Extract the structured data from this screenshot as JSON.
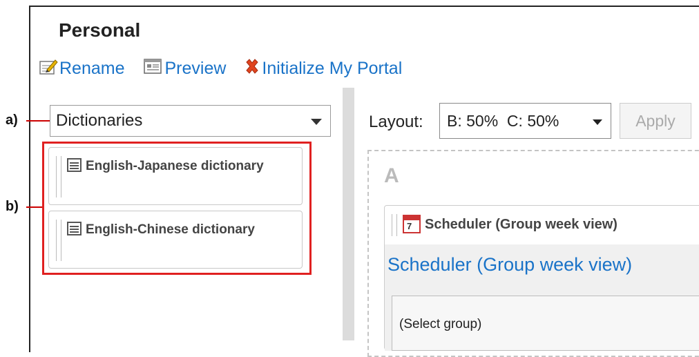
{
  "page": {
    "title": "Personal"
  },
  "toolbar": {
    "rename_label": "Rename",
    "preview_label": "Preview",
    "initialize_label": "Initialize My Portal"
  },
  "left": {
    "category_select": "Dictionaries",
    "items": [
      {
        "label": "English-Japanese dictionary"
      },
      {
        "label": "English-Chinese dictionary"
      }
    ]
  },
  "callouts": {
    "a": "a)",
    "b": "b)"
  },
  "right": {
    "layout_label": "Layout:",
    "layout_value": "B: 50%  C: 50%",
    "apply_label": "Apply",
    "area_letter": "A",
    "portlet": {
      "icon_day": "7",
      "title": "Scheduler (Group week view)",
      "link": "Scheduler (Group week view)",
      "select_group": "(Select group)"
    }
  },
  "colors": {
    "link": "#1a73c8",
    "highlight": "#e02020",
    "divider": "#dcdcdc"
  }
}
